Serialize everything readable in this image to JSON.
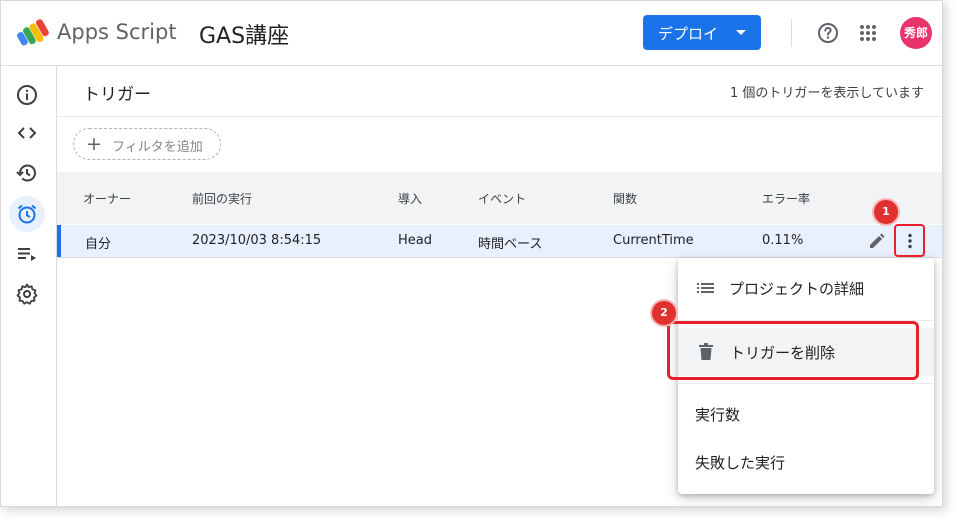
{
  "header": {
    "app_name": "Apps Script",
    "project_name": "GAS講座",
    "deploy_label": "デプロイ",
    "avatar_text": "秀郎"
  },
  "sidebar": {
    "items": [
      {
        "name": "overview",
        "icon": "info-icon"
      },
      {
        "name": "editor",
        "icon": "code-icon"
      },
      {
        "name": "executions",
        "icon": "history-icon"
      },
      {
        "name": "triggers",
        "icon": "alarm-icon",
        "active": true
      },
      {
        "name": "executions-log",
        "icon": "playlist-icon"
      },
      {
        "name": "settings",
        "icon": "gear-icon"
      }
    ]
  },
  "main": {
    "title": "トリガー",
    "trigger_count": "1 個のトリガーを表示しています",
    "filter_label": "フィルタを追加"
  },
  "table": {
    "headers": [
      "オーナー",
      "前回の実行",
      "導入",
      "イベント",
      "関数",
      "エラー率"
    ],
    "rows": [
      {
        "owner": "自分",
        "last_run": "2023/10/03 8:54:15",
        "deployment": "Head",
        "event": "時間ベース",
        "function": "CurrentTime",
        "error_rate": "0.11%"
      }
    ]
  },
  "menu": {
    "project_details": "プロジェクトの詳細",
    "delete_trigger": "トリガーを削除",
    "executions": "実行数",
    "failed_executions": "失敗した実行"
  },
  "annotations": {
    "badge1": "1",
    "badge2": "2"
  },
  "colors": {
    "accent": "#1a73e8",
    "highlight": "#e8202a",
    "avatar": "#e8336b"
  }
}
